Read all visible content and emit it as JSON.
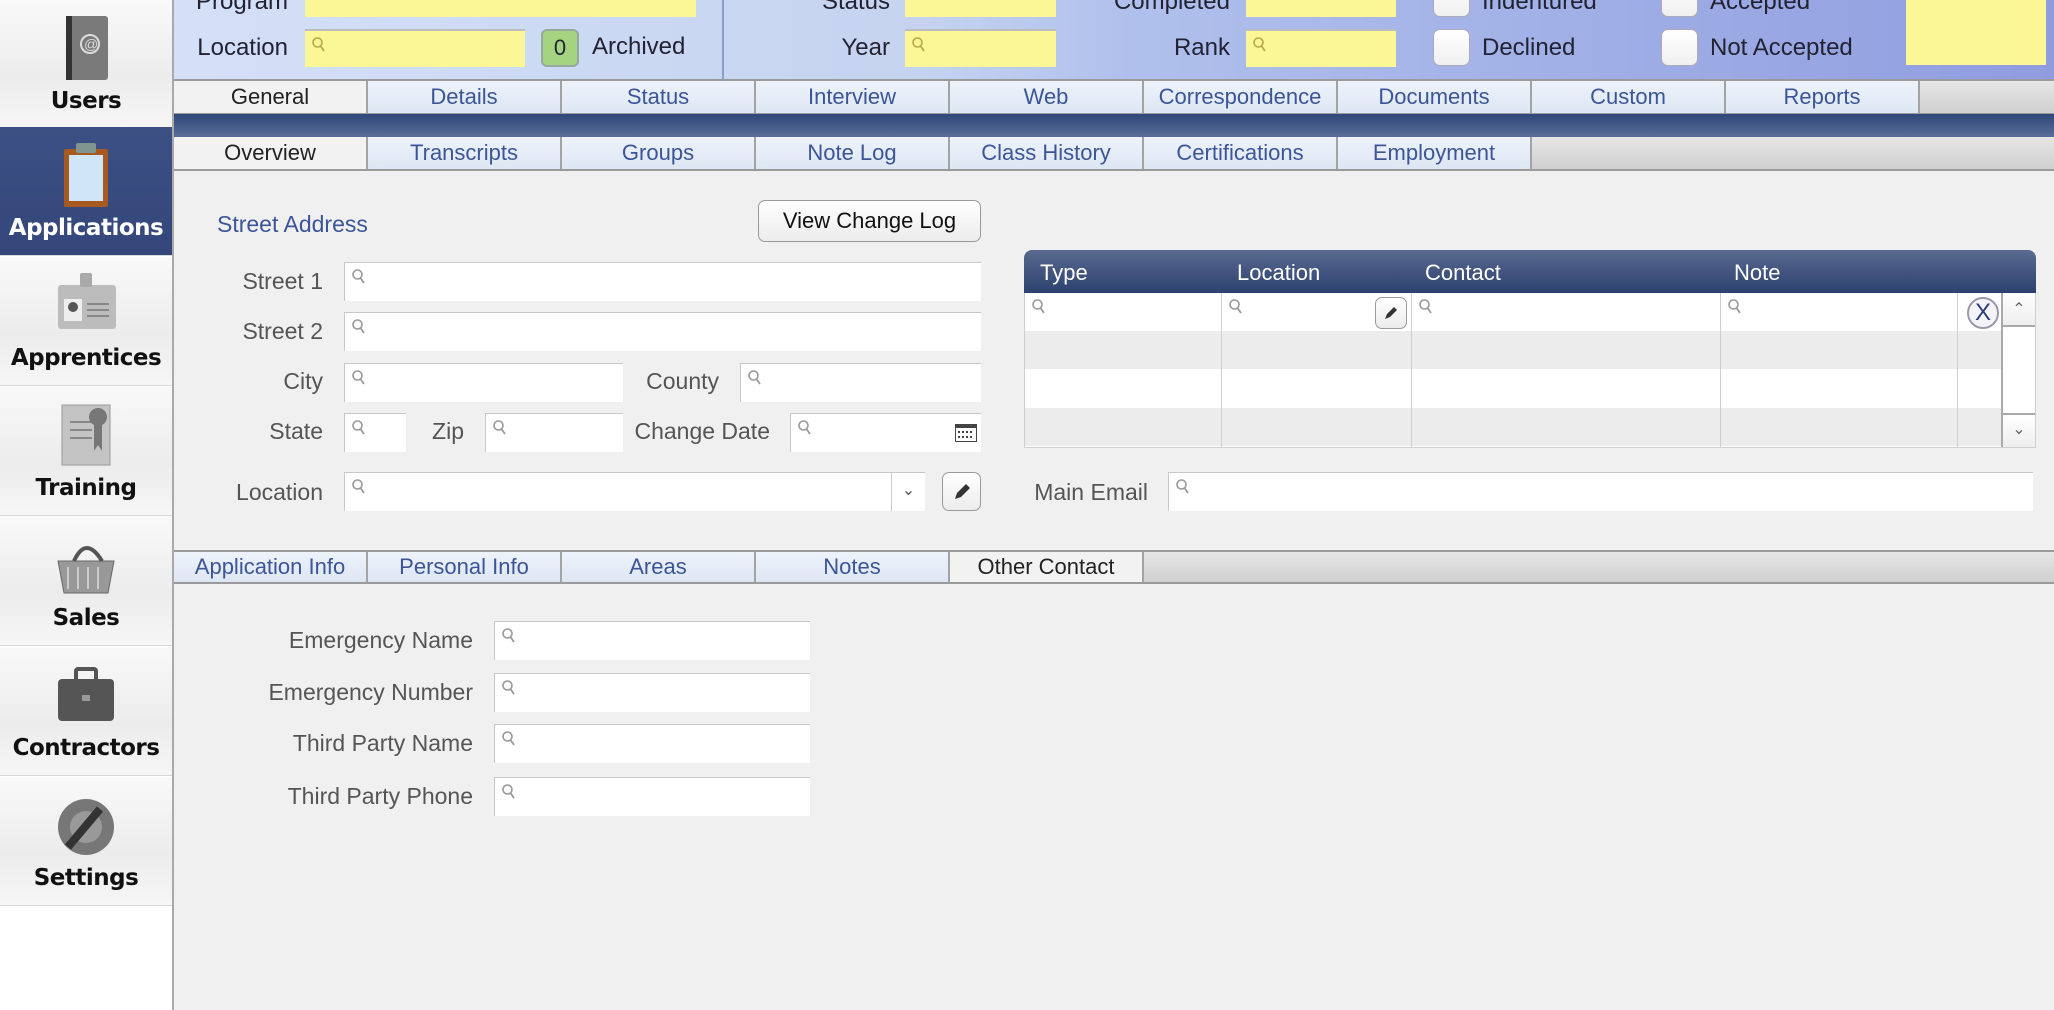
{
  "sidebar": {
    "items": [
      {
        "label": "Users",
        "icon": "address-book-icon"
      },
      {
        "label": "Applications",
        "icon": "clipboard-icon",
        "selected": true
      },
      {
        "label": "Apprentices",
        "icon": "id-badge-icon"
      },
      {
        "label": "Training",
        "icon": "certificate-icon"
      },
      {
        "label": "Sales",
        "icon": "basket-icon"
      },
      {
        "label": "Contractors",
        "icon": "briefcase-icon"
      },
      {
        "label": "Settings",
        "icon": "wrench-gear-icon"
      }
    ],
    "selected_color": "#3a4e82"
  },
  "header": {
    "program_label": "Program",
    "location_label": "Location",
    "archived_count": "0",
    "archived_label": "Archived",
    "status_label": "Status",
    "year_label": "Year",
    "completed_label": "Completed",
    "rank_label": "Rank",
    "indentured_label": "Indentured",
    "declined_label": "Declined",
    "accepted_label": "Accepted",
    "not_accepted_label": "Not Accepted",
    "field_color": "#fbf797"
  },
  "main_tabs": [
    "General",
    "Details",
    "Status",
    "Interview",
    "Web",
    "Correspondence",
    "Documents",
    "Custom",
    "Reports"
  ],
  "main_tab_selected": 0,
  "sub_tabs": [
    "Overview",
    "Transcripts",
    "Groups",
    "Note Log",
    "Class History",
    "Certifications",
    "Employment"
  ],
  "sub_tab_selected": 0,
  "address": {
    "section_title": "Street Address",
    "view_change_log": "View Change Log",
    "street1_label": "Street 1",
    "street2_label": "Street 2",
    "city_label": "City",
    "county_label": "County",
    "state_label": "State",
    "zip_label": "Zip",
    "change_date_label": "Change Date",
    "location_label": "Location"
  },
  "contact_grid": {
    "columns": [
      "Type",
      "Location",
      "Contact",
      "Note"
    ],
    "rows": 4,
    "delete_label": "X"
  },
  "main_email_label": "Main Email",
  "bottom_tabs": [
    "Application Info",
    "Personal Info",
    "Areas",
    "Notes",
    "Other Contact"
  ],
  "bottom_tab_selected": 4,
  "other_contact": {
    "fields": [
      "Emergency Name",
      "Emergency Number",
      "Third Party Name",
      "Third Party Phone"
    ]
  }
}
